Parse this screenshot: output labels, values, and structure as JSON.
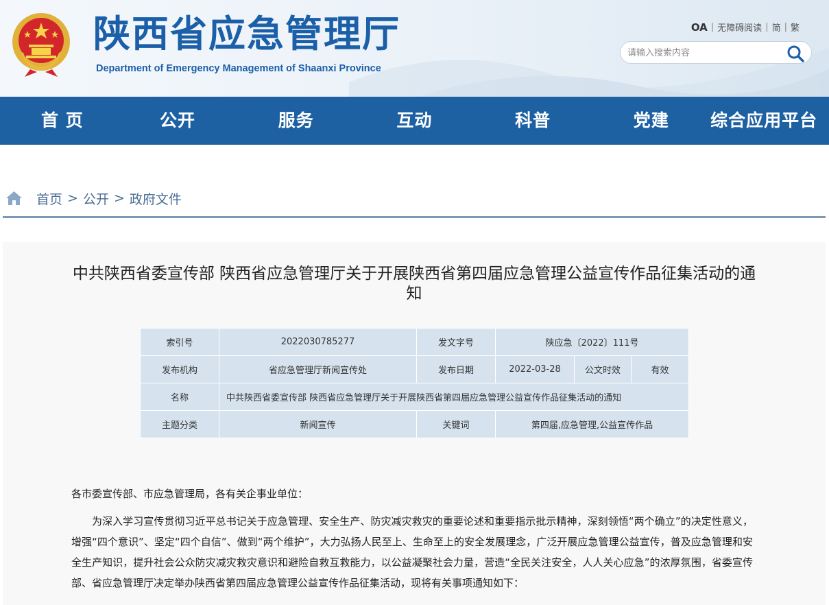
{
  "header": {
    "title": "陕西省应急管理厅",
    "subtitle": "Department of Emergency Management of Shaanxi Province",
    "links": {
      "oa": "OA",
      "accessibility": "无障碍阅读",
      "simplified": "简",
      "traditional": "繁",
      "separator": "|"
    },
    "search": {
      "placeholder": "请输入搜索内容",
      "value": ""
    },
    "colors": {
      "brand": "#1b5fa8",
      "nav": "#1d61a3"
    }
  },
  "nav": {
    "items": [
      "首 页",
      "公开",
      "服务",
      "互动",
      "科普",
      "党建",
      "综合应用平台"
    ]
  },
  "breadcrumb": {
    "items": [
      "首页",
      "公开",
      "政府文件"
    ],
    "separator": ">"
  },
  "article": {
    "title": "中共陕西省委宣传部 陕西省应急管理厅关于开展陕西省第四届应急管理公益宣传作品征集活动的通知",
    "meta": {
      "index_label": "索引号",
      "index_value": "2022030785277",
      "doc_no_label": "发文字号",
      "doc_no_value": "陕应急〔2022〕111号",
      "org_label": "发布机构",
      "org_value": "省应急管理厅新闻宣传处",
      "date_label": "发布日期",
      "date_value": "2022-03-28",
      "validity_label": "公文时效",
      "validity_value": "有效",
      "name_label": "名称",
      "name_value": "中共陕西省委宣传部 陕西省应急管理厅关于开展陕西省第四届应急管理公益宣传作品征集活动的通知",
      "topic_label": "主题分类",
      "topic_value": "新闻宣传",
      "keywords_label": "关键词",
      "keywords_value": "第四届,应急管理,公益宣传作品"
    },
    "greeting": "各市委宣传部、市应急管理局，各有关企事业单位：",
    "paragraph": "为深入学习宣传贯彻习近平总书记关于应急管理、安全生产、防灾减灾救灾的重要论述和重要指示批示精神，深刻领悟“两个确立”的决定性意义，增强“四个意识”、坚定“四个自信”、做到“两个维护”，大力弘扬人民至上、生命至上的安全发展理念，广泛开展应急管理公益宣传，普及应急管理和安全生产知识，提升社会公众防灾减灾救灾意识和避险自救互救能力，以公益凝聚社会力量，营造“全民关注安全，人人关心应急”的浓厚氛围，省委宣传部、省应急管理厅决定举办陕西省第四届应急管理公益宣传作品征集活动，现将有关事项通知如下："
  }
}
